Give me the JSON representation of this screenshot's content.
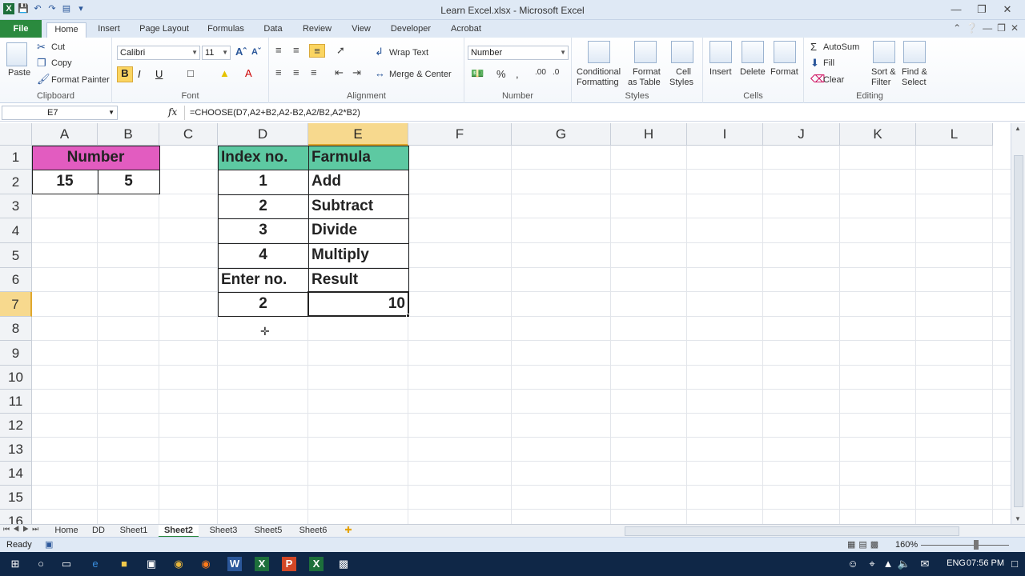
{
  "window": {
    "title": "Learn Excel.xlsx - Microsoft Excel"
  },
  "tabs": [
    "File",
    "Home",
    "Insert",
    "Page Layout",
    "Formulas",
    "Data",
    "Review",
    "View",
    "Developer",
    "Acrobat"
  ],
  "ribbon": {
    "clipboard": {
      "paste": "Paste",
      "cut": "Cut",
      "copy": "Copy",
      "format_painter": "Format Painter",
      "label": "Clipboard"
    },
    "font": {
      "name": "Calibri",
      "size": "11",
      "label": "Font"
    },
    "alignment": {
      "wrap": "Wrap Text",
      "merge": "Merge & Center",
      "label": "Alignment"
    },
    "number": {
      "format": "Number",
      "label": "Number"
    },
    "styles": {
      "conditional": [
        "Conditional",
        "Formatting"
      ],
      "table": [
        "Format",
        "as Table"
      ],
      "cell": [
        "Cell",
        "Styles"
      ],
      "label": "Styles"
    },
    "cells": {
      "insert": "Insert",
      "delete": "Delete",
      "format": "Format",
      "label": "Cells"
    },
    "editing": {
      "autosum": "AutoSum",
      "fill": "Fill",
      "clear": "Clear",
      "sort": [
        "Sort &",
        "Filter"
      ],
      "find": [
        "Find &",
        "Select"
      ],
      "label": "Editing"
    }
  },
  "formula_bar": {
    "name_box": "E7",
    "fx": "fx",
    "formula": "=CHOOSE(D7,A2+B2,A2-B2,A2/B2,A2*B2)"
  },
  "columns": [
    "A",
    "B",
    "C",
    "D",
    "E",
    "F",
    "G",
    "H",
    "I",
    "J",
    "K",
    "L"
  ],
  "rows": [
    "1",
    "2",
    "3",
    "4",
    "5",
    "6",
    "7",
    "8",
    "9",
    "10",
    "11",
    "12",
    "13",
    "14",
    "15",
    "16"
  ],
  "cells": {
    "A1": "Number",
    "A2": "15",
    "B2": "5",
    "D1": "Index no.",
    "E1": "Farmula",
    "D2": "1",
    "E2": "Add",
    "D3": "2",
    "E3": "Subtract",
    "D4": "3",
    "E4": "Divide",
    "D5": "4",
    "E5": "Multiply",
    "D6": "Enter no.",
    "E6": "Result",
    "D7": "2",
    "E7": "10"
  },
  "colors": {
    "header_pink": "#e25cc0",
    "header_green": "#5dc9a2",
    "file_tab": "#2a8a3e",
    "selected_header": "#f7d98e"
  },
  "sheets": [
    "Home",
    "DD",
    "Sheet1",
    "Sheet2",
    "Sheet3",
    "Sheet5",
    "Sheet6"
  ],
  "active_sheet": "Sheet2",
  "status": {
    "ready": "Ready",
    "zoom": "160%"
  },
  "taskbar": {
    "lang": "ENG",
    "time": "07:56 PM"
  }
}
